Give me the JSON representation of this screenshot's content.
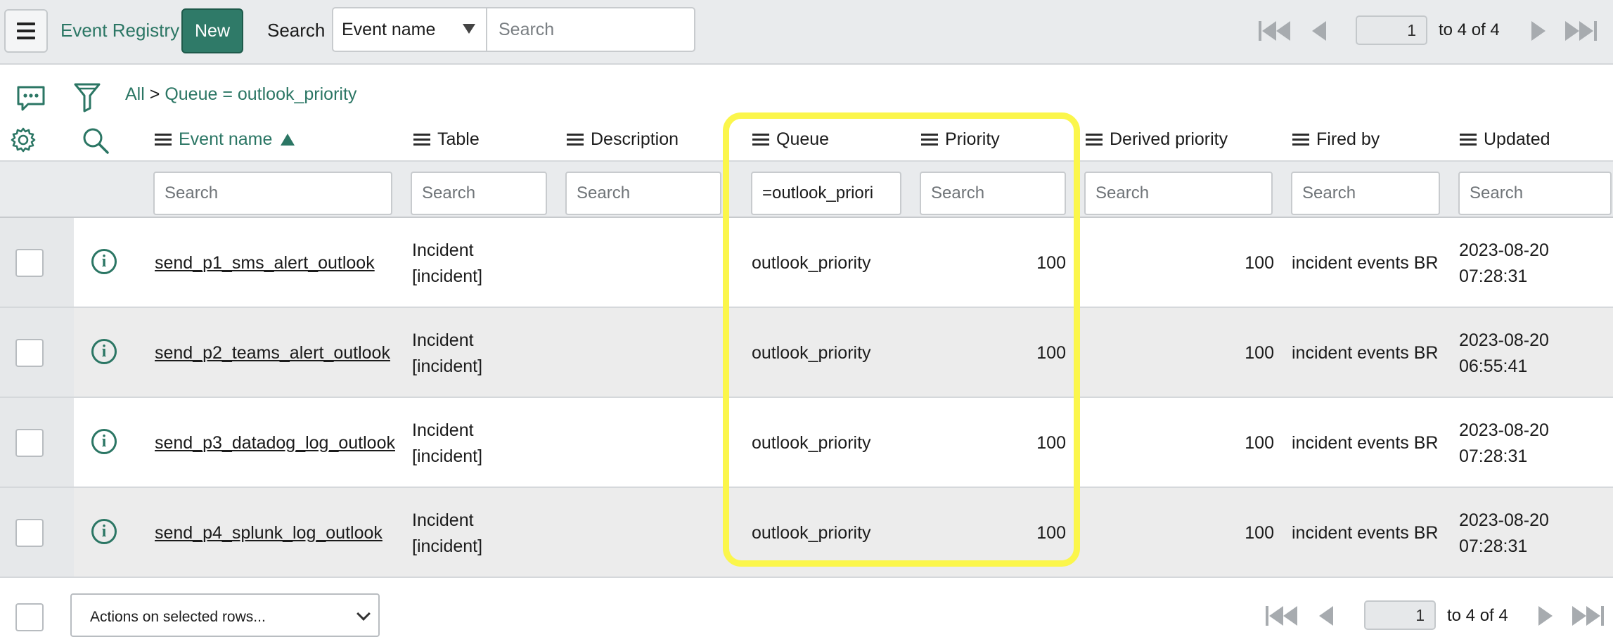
{
  "header": {
    "title": "Event Registry",
    "new_label": "New",
    "search_label": "Search",
    "search_field": "Event name",
    "search_placeholder": "Search",
    "page_value": "1",
    "page_text": "to 4 of 4"
  },
  "filter": {
    "all": "All",
    "separator": ">",
    "condition": "Queue = outlook_priority"
  },
  "columns": [
    "Event name",
    "Table",
    "Description",
    "Queue",
    "Priority",
    "Derived priority",
    "Fired by",
    "Updated"
  ],
  "search_row": {
    "placeholder": "Search",
    "queue_value": "=outlook_priori"
  },
  "rows": [
    {
      "event_name": "send_p1_sms_alert_outlook",
      "table_1": "Incident",
      "table_2": "[incident]",
      "description": "",
      "queue": "outlook_priority",
      "priority": "100",
      "derived_priority": "100",
      "fired_by": "incident events BR",
      "updated_1": "2023-08-20",
      "updated_2": "07:28:31"
    },
    {
      "event_name": "send_p2_teams_alert_outlook",
      "table_1": "Incident",
      "table_2": "[incident]",
      "description": "",
      "queue": "outlook_priority",
      "priority": "100",
      "derived_priority": "100",
      "fired_by": "incident events BR",
      "updated_1": "2023-08-20",
      "updated_2": "06:55:41"
    },
    {
      "event_name": "send_p3_datadog_log_outlook",
      "table_1": "Incident",
      "table_2": "[incident]",
      "description": "",
      "queue": "outlook_priority",
      "priority": "100",
      "derived_priority": "100",
      "fired_by": "incident events BR",
      "updated_1": "2023-08-20",
      "updated_2": "07:28:31"
    },
    {
      "event_name": "send_p4_splunk_log_outlook",
      "table_1": "Incident",
      "table_2": "[incident]",
      "description": "",
      "queue": "outlook_priority",
      "priority": "100",
      "derived_priority": "100",
      "fired_by": "incident events BR",
      "updated_1": "2023-08-20",
      "updated_2": "07:28:31"
    }
  ],
  "footer": {
    "actions_label": "Actions on selected rows...",
    "page_value": "1",
    "page_text": "to 4 of 4"
  },
  "colors": {
    "accent": "#2b7664",
    "highlight": "#fbf64b"
  }
}
